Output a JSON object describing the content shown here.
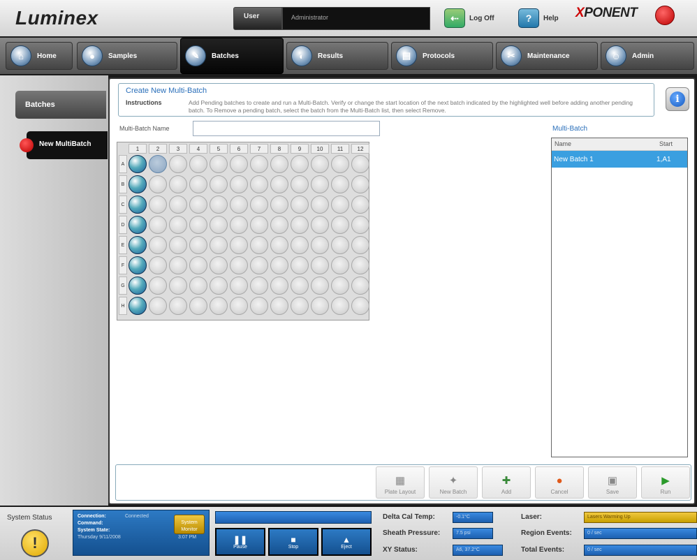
{
  "header": {
    "logo": "Luminex",
    "user_label": "User",
    "user_value": "Administrator",
    "logoff_label": "Log Off",
    "help_label": "Help",
    "xponent_x": "X",
    "xponent_rest": "PONENT"
  },
  "nav": {
    "tabs": [
      {
        "label": "Home"
      },
      {
        "label": "Samples"
      },
      {
        "label": "Batches"
      },
      {
        "label": "Results"
      },
      {
        "label": "Protocols"
      },
      {
        "label": "Maintenance"
      },
      {
        "label": "Admin"
      }
    ],
    "active": "Batches"
  },
  "sidebar": {
    "items": [
      {
        "label": "Batches"
      },
      {
        "label": "New MultiBatch"
      }
    ]
  },
  "instructions": {
    "title": "Create New Multi-Batch",
    "label": "Instructions",
    "text": "Add Pending batches to create and run a Multi-Batch. Verify or change the start location of the next batch indicated by the highlighted well before adding another pending batch. To Remove a pending batch, select the batch from the Multi-Batch list, then select Remove."
  },
  "form": {
    "name_label": "Multi-Batch Name",
    "name_value": ""
  },
  "plate": {
    "columns": [
      "1",
      "2",
      "3",
      "4",
      "5",
      "6",
      "7",
      "8",
      "9",
      "10",
      "11",
      "12"
    ],
    "rows": [
      "A",
      "B",
      "C",
      "D",
      "E",
      "F",
      "G",
      "H"
    ],
    "blue_column": 1,
    "selected_well": "A2"
  },
  "multibatch": {
    "title": "Multi-Batch",
    "columns": [
      "Name",
      "Start"
    ],
    "rows": [
      {
        "name": "New Batch 1",
        "start": "1,A1"
      }
    ]
  },
  "actions": [
    {
      "label": "Plate Layout"
    },
    {
      "label": "New Batch"
    },
    {
      "label": "Add"
    },
    {
      "label": "Cancel"
    },
    {
      "label": "Save"
    },
    {
      "label": "Run"
    }
  ],
  "status": {
    "title": "System Status",
    "connection_label": "Connection:",
    "connection_value": "Connected",
    "command_label": "Command:",
    "system_state_label": "System State:",
    "timestamp": "Thursday 9/11/2008",
    "time": "3:07 PM",
    "warning_button": "System Monitor",
    "controls": [
      {
        "label": "Pause"
      },
      {
        "label": "Stop"
      },
      {
        "label": "Eject"
      }
    ],
    "delta_cal_temp_label": "Delta Cal Temp:",
    "delta_cal_temp_value": "-0.1°C",
    "sheath_pressure_label": "Sheath Pressure:",
    "sheath_pressure_value": "7.5 psi",
    "xy_status_label": "XY Status:",
    "xy_status_value": "A6, 37.2°C",
    "laser_label": "Laser:",
    "laser_value": "Lasers Warming Up",
    "region_events_label": "Region Events:",
    "region_events_value": "0 / sec",
    "total_events_label": "Total Events:",
    "total_events_value": "0 / sec"
  }
}
